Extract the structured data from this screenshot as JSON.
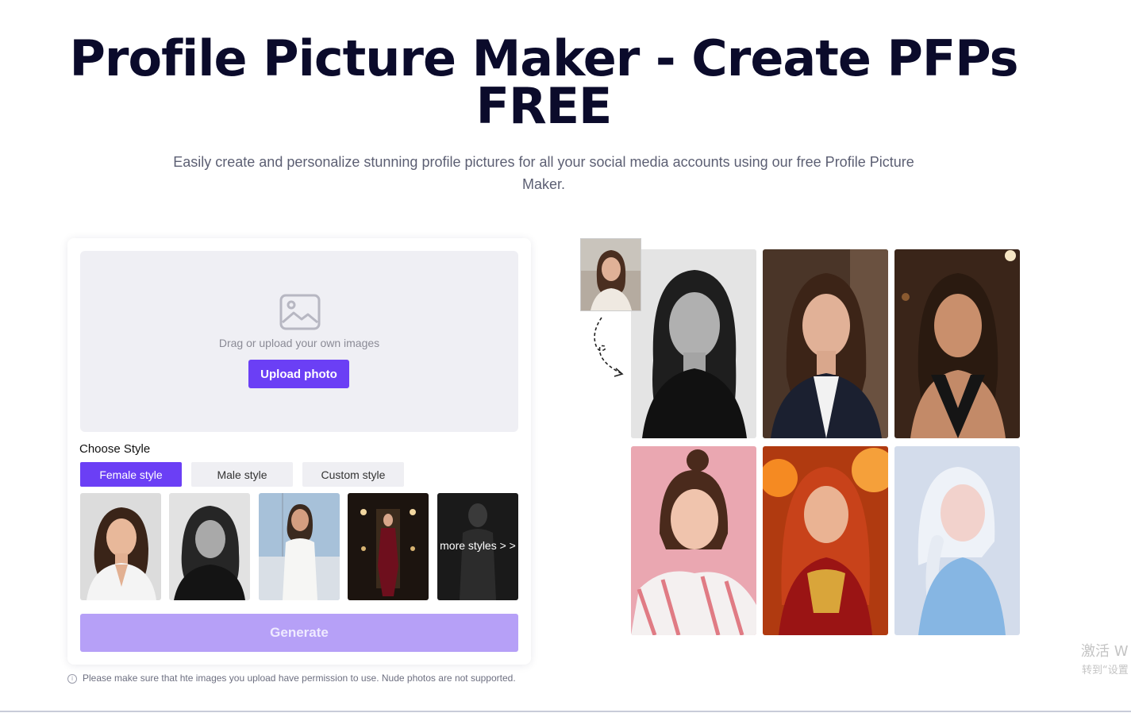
{
  "hero": {
    "title": "Profile Picture Maker - Create PFPs FREE",
    "subtitle": "Easily create and personalize stunning profile pictures for all your social media accounts using our free Profile Picture Maker."
  },
  "upload": {
    "drop_text": "Drag or upload your own images",
    "upload_label": "Upload photo"
  },
  "style": {
    "label": "Choose Style",
    "tabs": [
      {
        "label": "Female style",
        "active": true
      },
      {
        "label": "Male style",
        "active": false
      },
      {
        "label": "Custom style",
        "active": false
      }
    ],
    "more_label": "more styles > >"
  },
  "generate_label": "Generate",
  "note": "Please make sure that hte images you upload have permission to use. Nude photos are not supported.",
  "watermark": {
    "line1": "激活 W",
    "line2": "转到“设置"
  },
  "colors": {
    "accent": "#6b3ff5",
    "accent_disabled": "#b6a0f7",
    "dropzone_bg": "#efeff4"
  }
}
